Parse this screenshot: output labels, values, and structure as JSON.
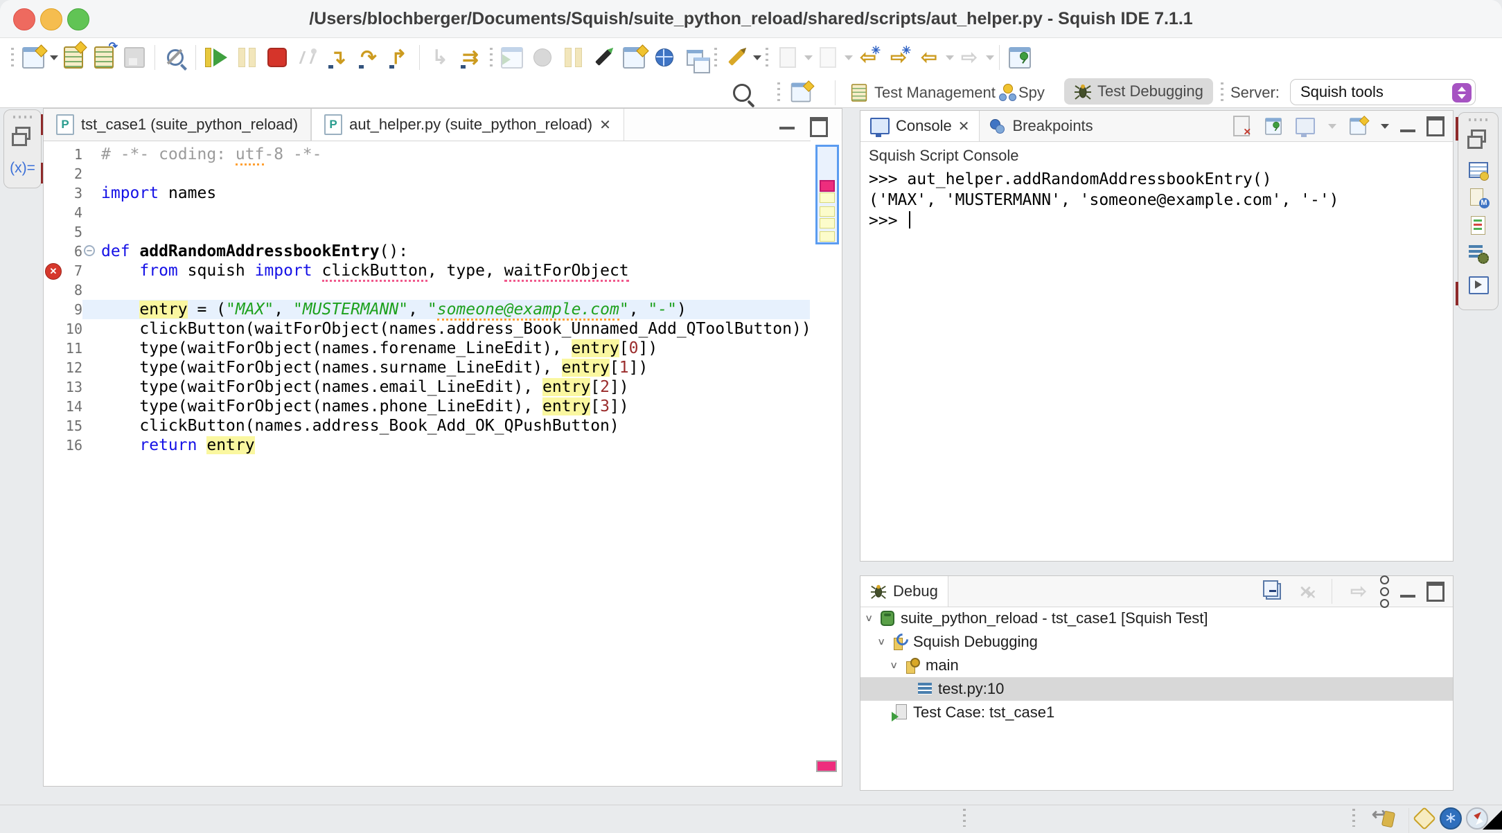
{
  "window": {
    "title": "/Users/blochberger/Documents/Squish/suite_python_reload/shared/scripts/aut_helper.py - Squish IDE 7.1.1"
  },
  "glyphs": {
    "close": "✕",
    "chevron": "∨",
    "minus": "−",
    "cross": "✕"
  },
  "icon_glyphs": {
    "step_into": "↴",
    "step_over": "↷",
    "step_return": "↱",
    "drop_frame": "↳",
    "step_through": "⇉",
    "back": "⇦",
    "forward": "⇨",
    "undo_arrow": "↩",
    "web_star": "∗"
  },
  "toolbar": {
    "row1_icons": [
      "new-test-suite-icon",
      "new-test-case-icon",
      "import-suite-icon",
      "save-icon",
      "object-not-picked-icon",
      "run-icon",
      "pause-icon",
      "stop-icon",
      "disconnect-icon",
      "step-into-icon",
      "step-over-icon",
      "step-return-icon",
      "drop-to-frame-icon",
      "step-through-icon",
      "record-window-icon",
      "record-icon",
      "interrupt-icon",
      "pick-object-icon",
      "snapshot-icon",
      "web-inspector-icon",
      "windows-icon",
      "highlight-object-icon",
      "import-log-icon",
      "export-log-icon",
      "jump-to-previous-icon",
      "jump-to-next-icon",
      "back-icon",
      "forward-icon",
      "pin-editor-icon"
    ]
  },
  "perspective_bar": {
    "test_management": "Test Management",
    "spy": "Spy",
    "test_debugging": "Test Debugging",
    "server_label": "Server:",
    "server_value": "Squish tools"
  },
  "left_minimized_bar": {
    "variables_glyph": "(x)="
  },
  "right_minimized_bar": {
    "icons": [
      "table-ball-icon",
      "doc-m-icon",
      "doc-list-icon",
      "list-gear-icon",
      "play-view-icon"
    ]
  },
  "editor": {
    "tabs": [
      {
        "label": "tst_case1 (suite_python_reload)",
        "active": false
      },
      {
        "label": "aut_helper.py (suite_python_reload)",
        "active": true
      }
    ],
    "lines": [
      {
        "num": 1,
        "tokens": [
          [
            "comment",
            "# -*- coding: "
          ],
          [
            "comment spell",
            "utf"
          ],
          [
            "comment",
            "-8 -*-"
          ]
        ]
      },
      {
        "num": 2,
        "tokens": []
      },
      {
        "num": 3,
        "tokens": [
          [
            "kw",
            "import"
          ],
          [
            "plain",
            " names"
          ]
        ]
      },
      {
        "num": 4,
        "tokens": []
      },
      {
        "num": 5,
        "tokens": []
      },
      {
        "num": 6,
        "fold": true,
        "tokens": [
          [
            "kw",
            "def "
          ],
          [
            "defname",
            "addRandomAddressbookEntry"
          ],
          [
            "plain",
            "():"
          ]
        ]
      },
      {
        "num": 7,
        "error": true,
        "tokens": [
          [
            "plain",
            "    "
          ],
          [
            "kw",
            "from"
          ],
          [
            "plain",
            " squish "
          ],
          [
            "kw",
            "import"
          ],
          [
            "plain",
            " "
          ],
          [
            "err",
            "clickButton"
          ],
          [
            "plain",
            ", type, "
          ],
          [
            "err",
            "waitForObject"
          ]
        ]
      },
      {
        "num": 8,
        "tokens": []
      },
      {
        "num": 9,
        "current": true,
        "tokens": [
          [
            "plain",
            "    "
          ],
          [
            "hl",
            "entry"
          ],
          [
            "plain",
            " = ("
          ],
          [
            "str",
            "\"MAX\""
          ],
          [
            "plain",
            ", "
          ],
          [
            "str",
            "\"MUSTERMANN\""
          ],
          [
            "plain",
            ", "
          ],
          [
            "str",
            "\""
          ],
          [
            "str spell",
            "someone@example.com"
          ],
          [
            "str",
            "\""
          ],
          [
            "plain",
            ", "
          ],
          [
            "str",
            "\"-\""
          ],
          [
            "plain",
            ")"
          ]
        ]
      },
      {
        "num": 10,
        "tokens": [
          [
            "plain",
            "    clickButton(waitForObject(names.address_Book_Unnamed_Add_QToolButton))"
          ]
        ]
      },
      {
        "num": 11,
        "tokens": [
          [
            "plain",
            "    type(waitForObject(names.forename_LineEdit), "
          ],
          [
            "hl",
            "entry"
          ],
          [
            "plain",
            "["
          ],
          [
            "num",
            "0"
          ],
          [
            "plain",
            "])"
          ]
        ]
      },
      {
        "num": 12,
        "tokens": [
          [
            "plain",
            "    type(waitForObject(names.surname_LineEdit), "
          ],
          [
            "hl",
            "entry"
          ],
          [
            "plain",
            "["
          ],
          [
            "num",
            "1"
          ],
          [
            "plain",
            "])"
          ]
        ]
      },
      {
        "num": 13,
        "tokens": [
          [
            "plain",
            "    type(waitForObject(names.email_LineEdit), "
          ],
          [
            "hl",
            "entry"
          ],
          [
            "plain",
            "["
          ],
          [
            "num",
            "2"
          ],
          [
            "plain",
            "])"
          ]
        ]
      },
      {
        "num": 14,
        "tokens": [
          [
            "plain",
            "    type(waitForObject(names.phone_LineEdit), "
          ],
          [
            "hl",
            "entry"
          ],
          [
            "plain",
            "["
          ],
          [
            "num",
            "3"
          ],
          [
            "plain",
            "])"
          ]
        ]
      },
      {
        "num": 15,
        "tokens": [
          [
            "plain",
            "    clickButton(names.address_Book_Add_OK_QPushButton)"
          ]
        ]
      },
      {
        "num": 16,
        "tokens": [
          [
            "plain",
            "    "
          ],
          [
            "kw",
            "return"
          ],
          [
            "plain",
            " "
          ],
          [
            "hl",
            "entry"
          ]
        ]
      }
    ]
  },
  "console": {
    "tabs": [
      {
        "label": "Console",
        "active": true
      },
      {
        "label": "Breakpoints",
        "active": false
      }
    ],
    "subtitle": "Squish Script Console",
    "lines": [
      ">>> aut_helper.addRandomAddressbookEntry()",
      "('MAX', 'MUSTERMANN', 'someone@example.com', '-')",
      ">>> "
    ]
  },
  "debug": {
    "title": "Debug",
    "tree": [
      {
        "depth": 0,
        "chevron": true,
        "icon": "squish-test-icon",
        "label": "suite_python_reload - tst_case1 [Squish Test]",
        "selected": false
      },
      {
        "depth": 1,
        "chevron": true,
        "icon": "squish-debugging-icon",
        "label": "Squish Debugging",
        "selected": false
      },
      {
        "depth": 2,
        "chevron": true,
        "icon": "thread-icon",
        "label": "main",
        "selected": false
      },
      {
        "depth": 3,
        "chevron": false,
        "icon": "stack-frame-icon",
        "label": "test.py:10",
        "selected": true
      },
      {
        "depth": 1,
        "chevron": false,
        "icon": "test-case-icon",
        "label": "Test Case: tst_case1",
        "selected": false
      }
    ]
  },
  "status_bar": {
    "icons": [
      "restore-tag-icon",
      "sparkle-icon",
      "web-icon",
      "compass-icon"
    ]
  },
  "colors": {
    "keyword": "#1511e6",
    "string": "#1ea11e",
    "comment": "#9b9b9b",
    "number": "#9a2b2b",
    "occurrence_highlight": "#faf7a0",
    "current_line": "#e7f1fd",
    "error_red": "#d6382c",
    "overview_error_pink": "#ee2d7d",
    "selection_gray": "#d8d8d8",
    "chip_gray": "#dadada",
    "server_stepper_purple": "#a653c2",
    "run_green": "#3fa03f",
    "stop_red": "#d5342a",
    "gold": "#cc9b1f"
  }
}
